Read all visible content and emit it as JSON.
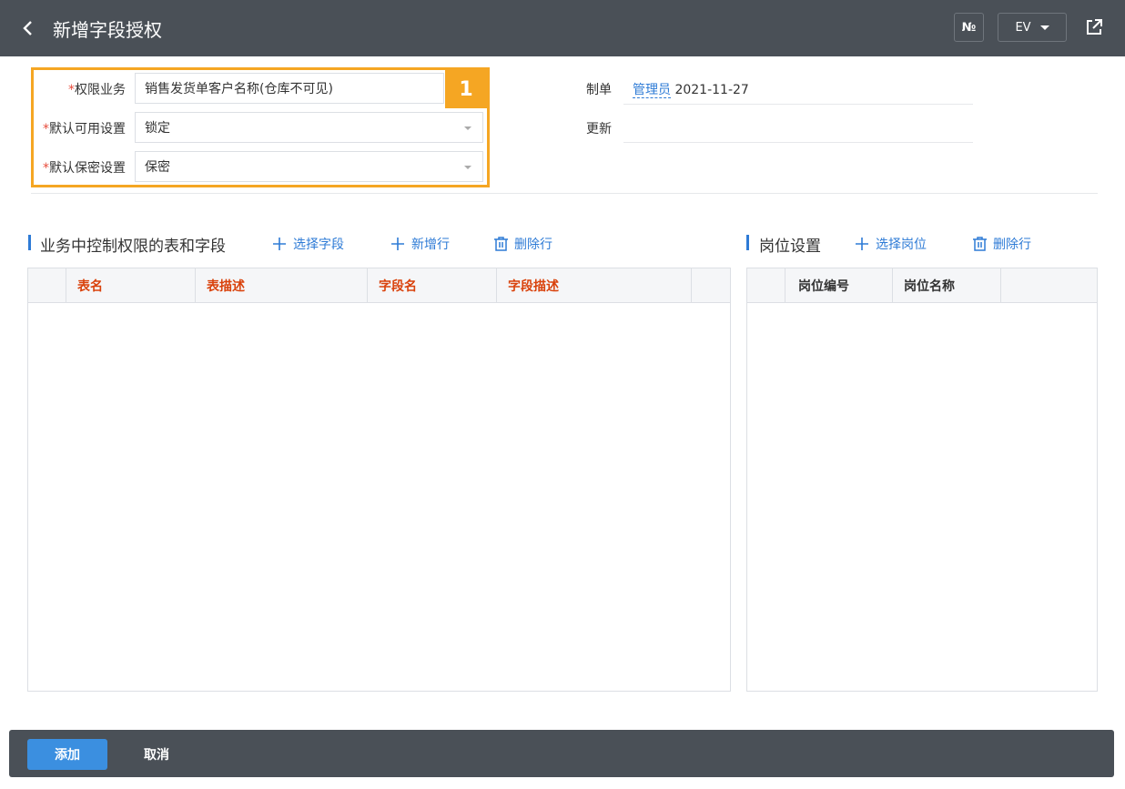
{
  "header": {
    "title": "新增字段授权",
    "no_label": "№",
    "lang_label": "EV"
  },
  "form": {
    "badge": "1",
    "required_mark": "*",
    "business": {
      "label": "权限业务",
      "value": "销售发货单客户名称(仓库不可见)"
    },
    "default_available": {
      "label": "默认可用设置",
      "value": "锁定"
    },
    "default_secret": {
      "label": "默认保密设置",
      "value": "保密"
    }
  },
  "meta": {
    "creator_label": "制单",
    "creator_name": "管理员",
    "creator_date": "2021-11-27",
    "update_label": "更新",
    "update_value": ""
  },
  "fields_section": {
    "title": "业务中控制权限的表和字段",
    "select_field": "选择字段",
    "add_row": "新增行",
    "delete_row": "删除行",
    "columns": [
      "表名",
      "表描述",
      "字段名",
      "字段描述"
    ]
  },
  "position_section": {
    "title": "岗位设置",
    "select_position": "选择岗位",
    "delete_row": "删除行",
    "columns": [
      "岗位编号",
      "岗位名称"
    ]
  },
  "footer": {
    "add_label": "添加",
    "cancel_label": "取消"
  },
  "colors": {
    "header_bg": "#4a5057",
    "accent": "#2e7bd6",
    "highlight": "#f5a623",
    "column_red": "#d9420c"
  }
}
